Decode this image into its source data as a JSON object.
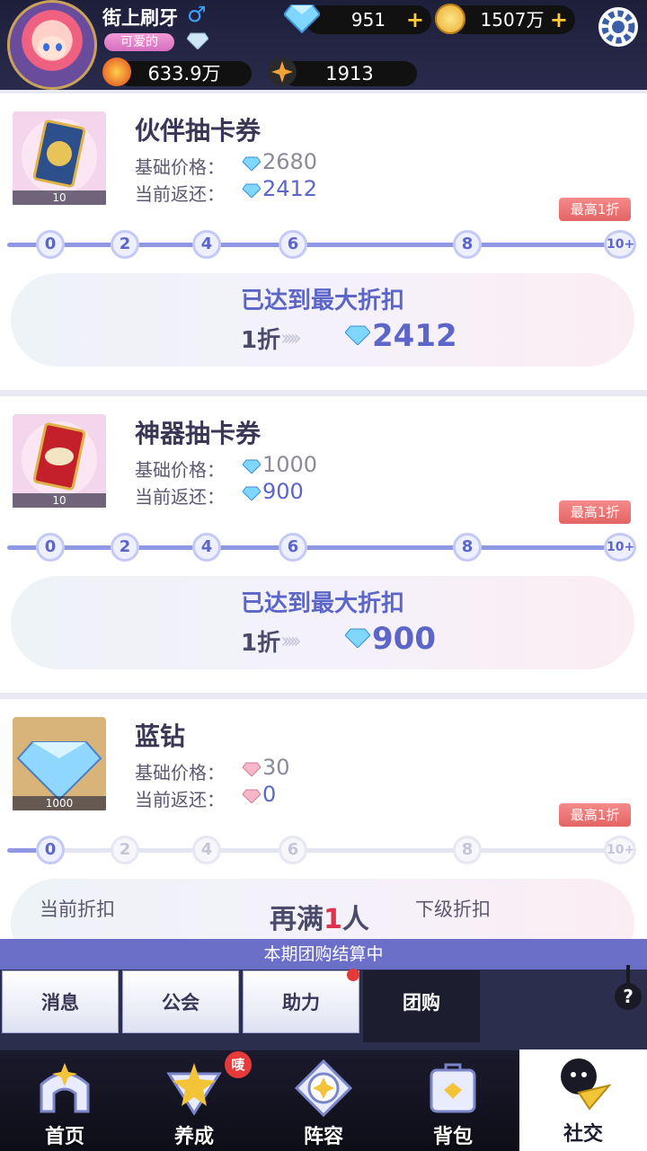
{
  "player": {
    "name": "街上刷牙",
    "gender_symbol": "♂",
    "title": "可爱的"
  },
  "resources": {
    "diamonds": "951",
    "coins": "1507万",
    "power": "633.9万",
    "stars": "1913"
  },
  "offers": [
    {
      "name": "伙伴抽卡券",
      "qty": "10",
      "base_label": "基础价格：",
      "base_price": "2680",
      "rebate_label": "当前返还：",
      "rebate": "2412",
      "badge": "最高1折",
      "milestones": [
        "0",
        "2",
        "4",
        "6",
        "8",
        "10+"
      ],
      "status": "已达到最大折扣",
      "discount": "1折",
      "final_price": "2412"
    },
    {
      "name": "神器抽卡券",
      "qty": "10",
      "base_label": "基础价格：",
      "base_price": "1000",
      "rebate_label": "当前返还：",
      "rebate": "900",
      "badge": "最高1折",
      "milestones": [
        "0",
        "2",
        "4",
        "6",
        "8",
        "10+"
      ],
      "status": "已达到最大折扣",
      "discount": "1折",
      "final_price": "900"
    },
    {
      "name": "蓝钻",
      "qty": "1000",
      "base_label": "基础价格：",
      "base_price": "30",
      "rebate_label": "当前返还：",
      "rebate": "0",
      "badge": "最高1折",
      "milestones": [
        "0",
        "2",
        "4",
        "6",
        "8",
        "10+"
      ],
      "current_discount_label": "当前折扣",
      "next_discount_label": "下级折扣",
      "need_more_prefix": "再满",
      "need_more_count": "1",
      "need_more_suffix": "人"
    }
  ],
  "settlement_notice": "本期团购结算中",
  "tabs": [
    "消息",
    "公会",
    "助力",
    "团购"
  ],
  "help_symbol": "?",
  "nav": {
    "items": [
      "首页",
      "养成",
      "阵容",
      "背包",
      "社交"
    ],
    "new_badge": "唛"
  },
  "colors": {
    "accent": "#5b66c8",
    "badge": "#e36464",
    "dark": "#1d1d30"
  }
}
